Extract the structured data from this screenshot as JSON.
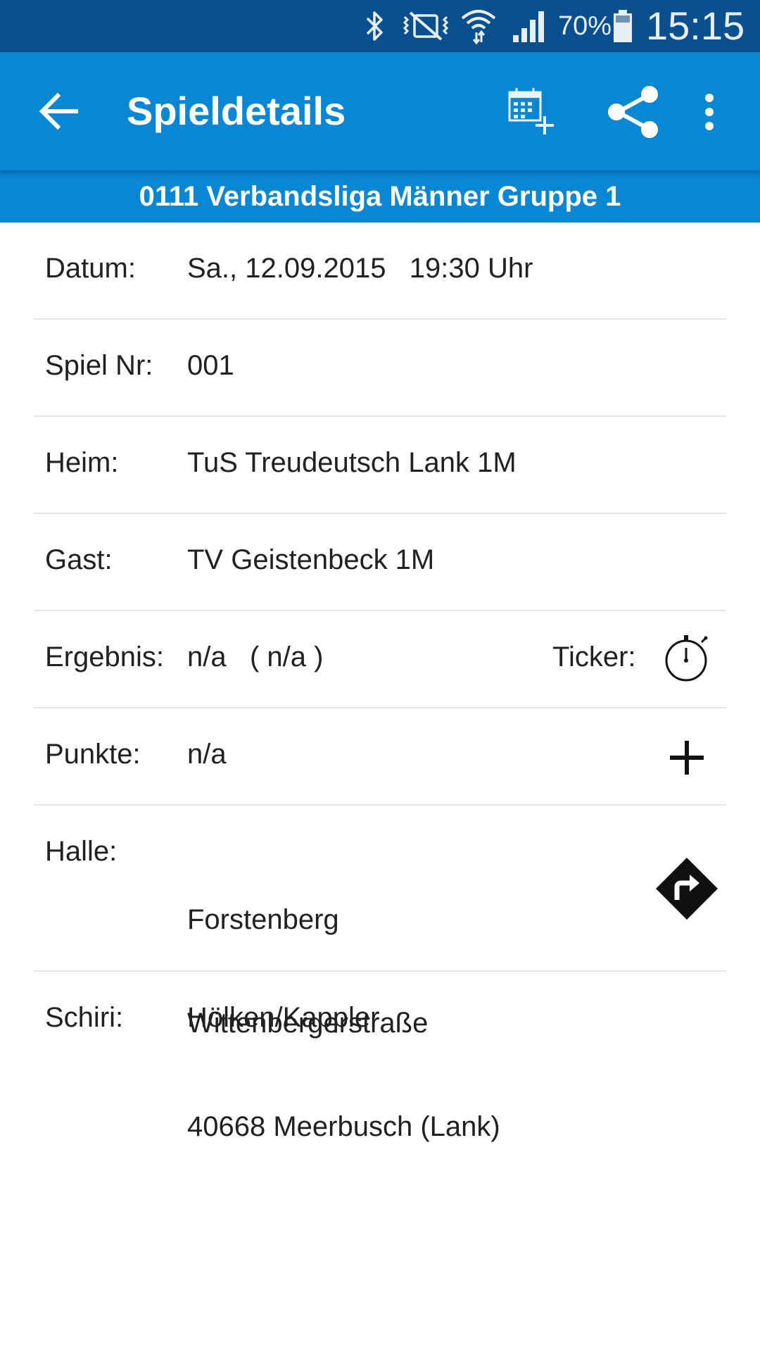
{
  "status_bar": {
    "battery_percent": "70%",
    "time": "15:15",
    "icons": [
      "bluetooth-icon",
      "vibrate-icon",
      "wifi-icon",
      "signal-icon",
      "battery-icon"
    ]
  },
  "app_bar": {
    "title": "Spieldetails",
    "actions": [
      "back-arrow-icon",
      "calendar-add-icon",
      "share-icon",
      "more-vert-icon"
    ]
  },
  "league": "0111 Verbandsliga Männer Gruppe 1",
  "details": {
    "datum": {
      "label": "Datum:",
      "value": "Sa., 12.09.2015   19:30 Uhr"
    },
    "spiel_nr": {
      "label": "Spiel Nr:",
      "value": "001"
    },
    "heim": {
      "label": "Heim:",
      "value": "TuS Treudeutsch Lank 1M"
    },
    "gast": {
      "label": "Gast:",
      "value": "TV Geistenbeck 1M"
    },
    "ergebnis": {
      "label": "Ergebnis:",
      "value": "n/a   ( n/a )",
      "ticker_label": "Ticker:"
    },
    "punkte": {
      "label": "Punkte:",
      "value": "n/a"
    },
    "halle": {
      "label": "Halle:",
      "name": "Forstenberg",
      "street": "Wittenbergerstraße",
      "city": "40668 Meerbusch (Lank)"
    },
    "schiri": {
      "label": "Schiri:",
      "value": "Hölken/Kappler"
    }
  },
  "colors": {
    "status_bar": "#0b4f8f",
    "app_bar": "#0a87d4",
    "divider": "#e2e2e2",
    "text": "#212121"
  }
}
